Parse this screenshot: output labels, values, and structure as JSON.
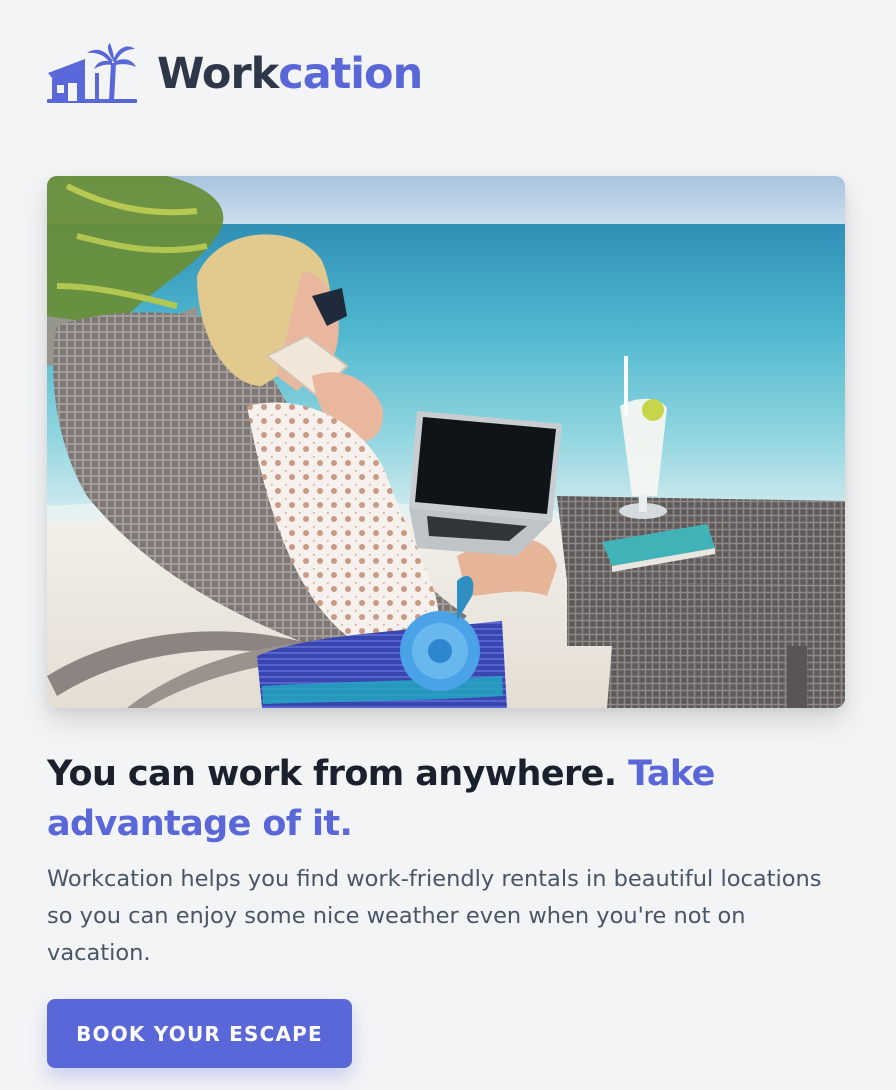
{
  "brand": {
    "name_part1": "Work",
    "name_part2": "cation",
    "logo_icon": "house-with-palm-tree-icon",
    "colors": {
      "primary": "#5a67d8",
      "dark": "#2d3748"
    }
  },
  "hero": {
    "image_icon": "beach-workcation-photo"
  },
  "headline": {
    "main": "You can work from anywhere.",
    "accent": "Take advantage of it."
  },
  "description": "Workcation helps you find work-friendly rentals in beautiful locations so you can enjoy some nice weather even when you're not on vacation.",
  "cta": {
    "label": "BOOK YOUR ESCAPE"
  }
}
